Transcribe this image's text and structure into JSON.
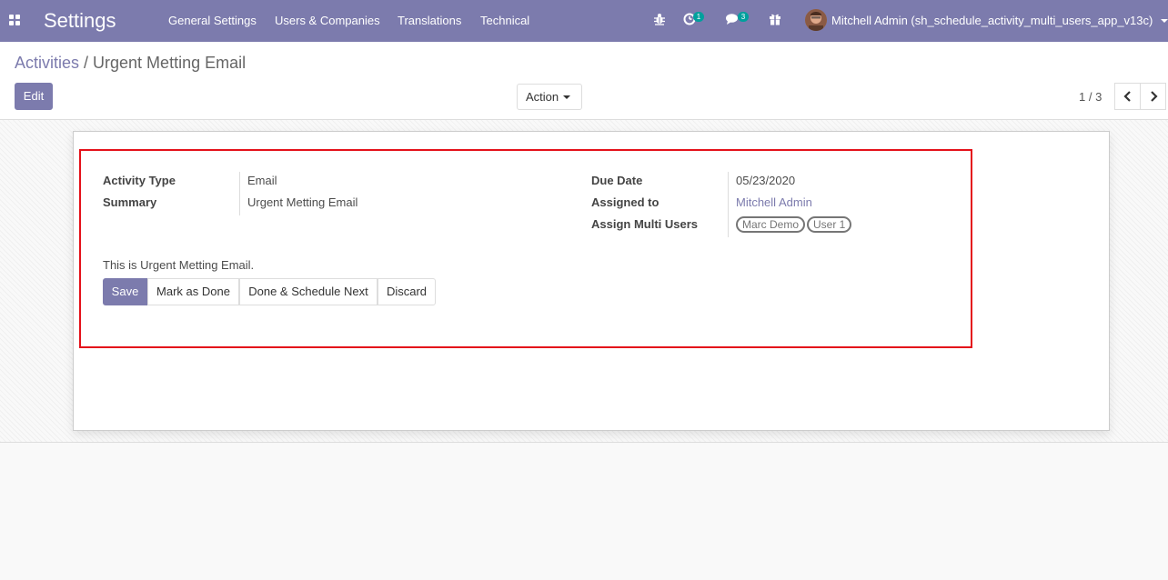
{
  "navbar": {
    "app_title": "Settings",
    "menu": [
      "General Settings",
      "Users & Companies",
      "Translations",
      "Technical"
    ],
    "activity_count": "1",
    "message_count": "3",
    "user_name": "Mitchell Admin (sh_schedule_activity_multi_users_app_v13c)",
    "icons": [
      "apps-icon",
      "bug-icon",
      "clock-icon",
      "chat-icon",
      "gift-icon"
    ],
    "bg_color": "#7c7bad"
  },
  "breadcrumb": {
    "parent": "Activities",
    "separator": "/",
    "current": "Urgent Metting Email"
  },
  "toolbar": {
    "edit_label": "Edit",
    "action_label": "Action"
  },
  "pager": {
    "value": "1 / 3"
  },
  "form": {
    "activity_type_label": "Activity Type",
    "activity_type_value": "Email",
    "summary_label": "Summary",
    "summary_value": "Urgent Metting Email",
    "due_date_label": "Due Date",
    "due_date_value": "05/23/2020",
    "assigned_to_label": "Assigned to",
    "assigned_to_value": "Mitchell Admin",
    "multi_users_label": "Assign Multi Users",
    "multi_users": [
      "Marc Demo",
      "User 1"
    ],
    "note": "This is Urgent Metting Email."
  },
  "buttons": {
    "save": "Save",
    "mark_done": "Mark as Done",
    "done_schedule": "Done & Schedule Next",
    "discard": "Discard"
  },
  "colors": {
    "primary": "#7c7bad",
    "highlight": "#e4111a",
    "badge": "#00a09d"
  }
}
